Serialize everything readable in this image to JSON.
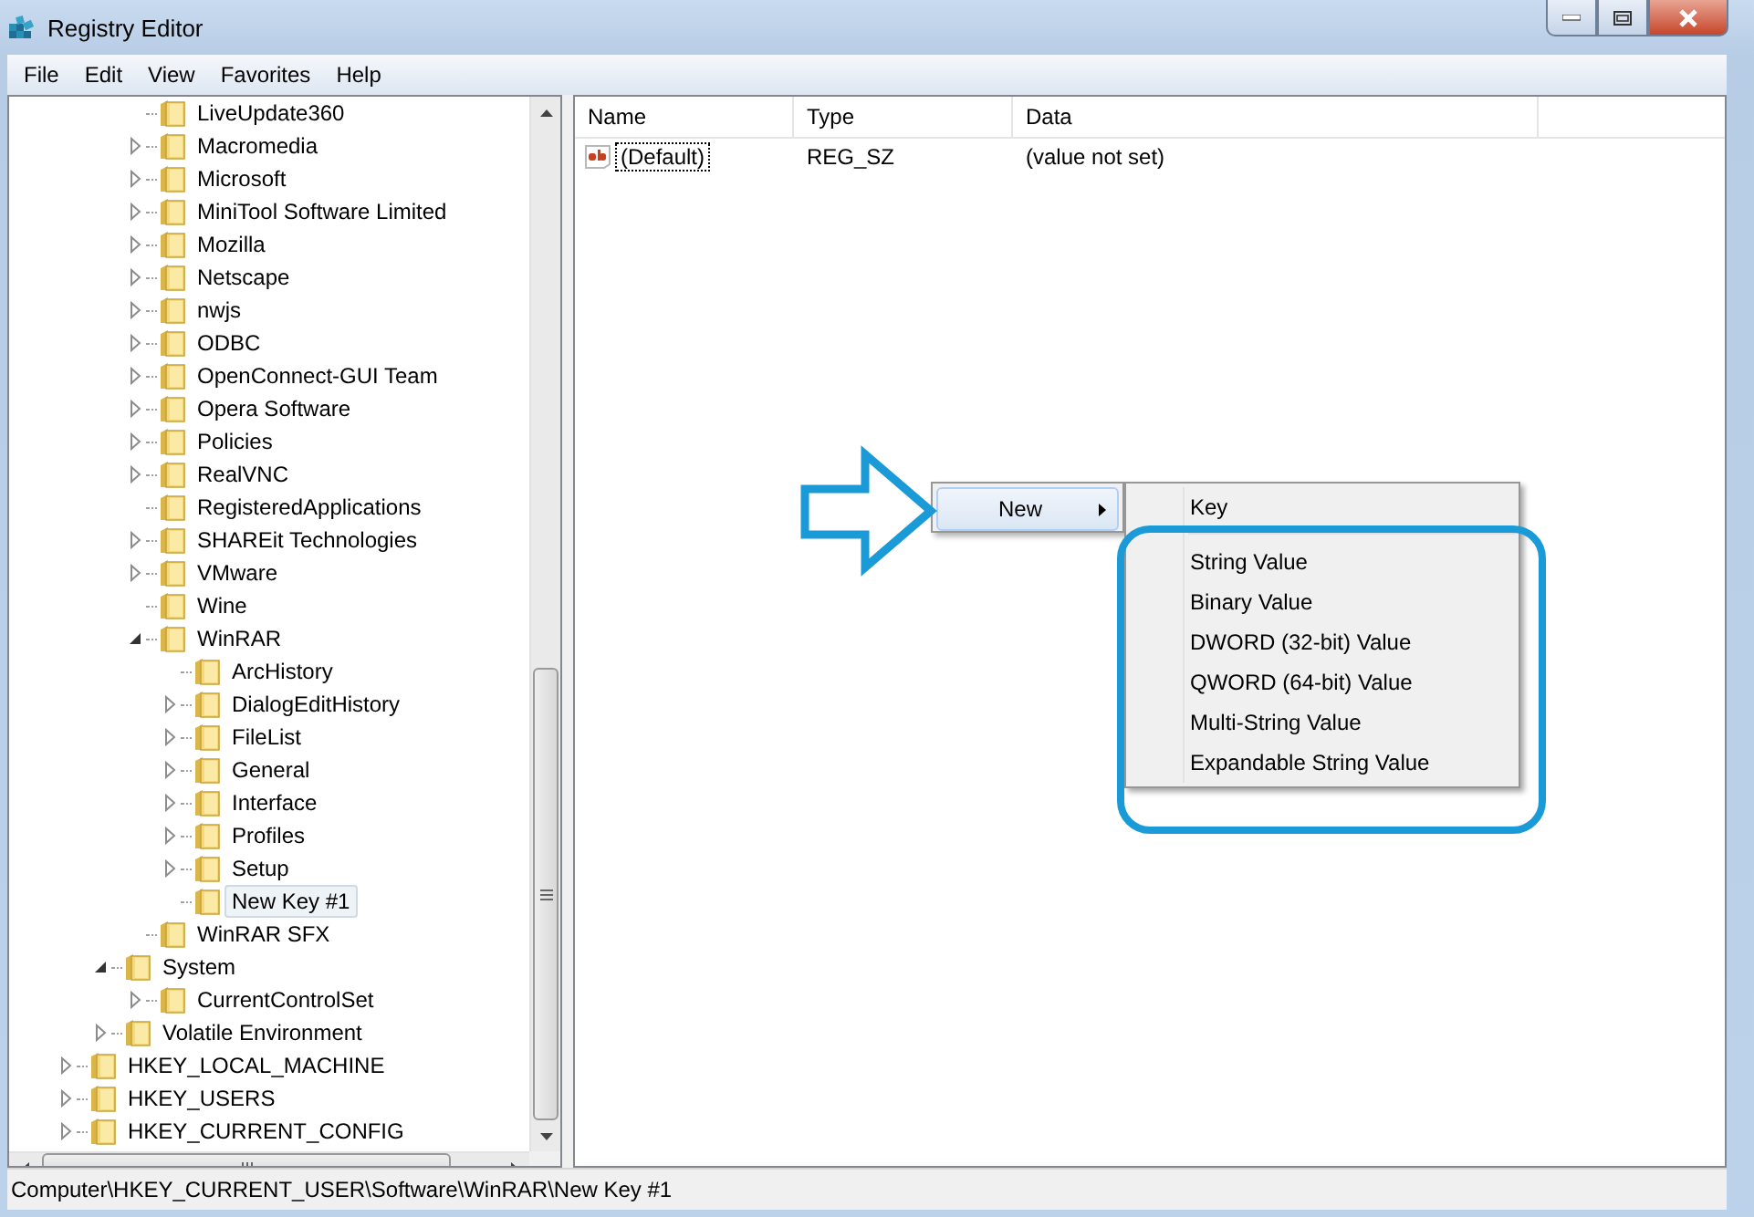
{
  "window": {
    "title": "Registry Editor"
  },
  "menu_bar": [
    "File",
    "Edit",
    "View",
    "Favorites",
    "Help"
  ],
  "tree": {
    "items": [
      {
        "children": [
          {
            "children": [
              {
                "label": "LiveUpdate360",
                "kind": "leaf",
                "selected": false
              },
              {
                "label": "Macromedia",
                "kind": "branch",
                "expanded": false,
                "selected": false
              },
              {
                "label": "Microsoft",
                "kind": "branch",
                "expanded": false,
                "selected": false
              },
              {
                "label": "MiniTool Software Limited",
                "kind": "branch",
                "expanded": false,
                "selected": false
              },
              {
                "label": "Mozilla",
                "kind": "branch",
                "expanded": false,
                "selected": false
              },
              {
                "label": "Netscape",
                "kind": "branch",
                "expanded": false,
                "selected": false
              },
              {
                "label": "nwjs",
                "kind": "branch",
                "expanded": false,
                "selected": false
              },
              {
                "label": "ODBC",
                "kind": "branch",
                "expanded": false,
                "selected": false
              },
              {
                "label": "OpenConnect-GUI Team",
                "kind": "branch",
                "expanded": false,
                "selected": false
              },
              {
                "label": "Opera Software",
                "kind": "branch",
                "expanded": false,
                "selected": false
              },
              {
                "label": "Policies",
                "kind": "branch",
                "expanded": false,
                "selected": false
              },
              {
                "label": "RealVNC",
                "kind": "branch",
                "expanded": false,
                "selected": false
              },
              {
                "label": "RegisteredApplications",
                "kind": "leaf",
                "selected": false
              },
              {
                "label": "SHAREit Technologies",
                "kind": "branch",
                "expanded": false,
                "selected": false
              },
              {
                "label": "VMware",
                "kind": "branch",
                "expanded": false,
                "selected": false
              },
              {
                "label": "Wine",
                "kind": "leaf",
                "selected": false
              },
              {
                "label": "WinRAR",
                "kind": "branch",
                "expanded": true,
                "selected": false,
                "children": [
                  {
                    "label": "ArcHistory",
                    "kind": "leaf",
                    "selected": false
                  },
                  {
                    "label": "DialogEditHistory",
                    "kind": "branch",
                    "expanded": false,
                    "selected": false
                  },
                  {
                    "label": "FileList",
                    "kind": "branch",
                    "expanded": false,
                    "selected": false
                  },
                  {
                    "label": "General",
                    "kind": "branch",
                    "expanded": false,
                    "selected": false
                  },
                  {
                    "label": "Interface",
                    "kind": "branch",
                    "expanded": false,
                    "selected": false
                  },
                  {
                    "label": "Profiles",
                    "kind": "branch",
                    "expanded": false,
                    "selected": false
                  },
                  {
                    "label": "Setup",
                    "kind": "branch",
                    "expanded": false,
                    "selected": false
                  },
                  {
                    "label": "New Key #1",
                    "kind": "leaf",
                    "selected": true
                  }
                ]
              },
              {
                "label": "WinRAR SFX",
                "kind": "leaf",
                "selected": false
              }
            ]
          },
          {
            "label": "System",
            "kind": "branch",
            "expanded": true,
            "selected": false,
            "children": [
              {
                "label": "CurrentControlSet",
                "kind": "branch",
                "expanded": false,
                "selected": false
              }
            ]
          },
          {
            "label": "Volatile Environment",
            "kind": "branch",
            "expanded": false,
            "selected": false
          }
        ]
      },
      {
        "label": "HKEY_LOCAL_MACHINE",
        "kind": "branch",
        "expanded": false,
        "selected": false
      },
      {
        "label": "HKEY_USERS",
        "kind": "branch",
        "expanded": false,
        "selected": false
      },
      {
        "label": "HKEY_CURRENT_CONFIG",
        "kind": "branch",
        "expanded": false,
        "selected": false
      }
    ]
  },
  "values": {
    "columns": [
      "Name",
      "Type",
      "Data"
    ],
    "rows": [
      {
        "name": "(Default)",
        "type": "REG_SZ",
        "data": "(value not set)",
        "selected": true
      }
    ]
  },
  "context_menu": {
    "items": [
      {
        "label": "New",
        "has_submenu": true,
        "selected": true
      }
    ]
  },
  "submenu": {
    "items": [
      {
        "kind": "item",
        "label": "Key"
      },
      {
        "kind": "separator"
      },
      {
        "kind": "item",
        "label": "String Value"
      },
      {
        "kind": "item",
        "label": "Binary Value"
      },
      {
        "kind": "item",
        "label": "DWORD (32-bit) Value"
      },
      {
        "kind": "item",
        "label": "QWORD (64-bit) Value"
      },
      {
        "kind": "item",
        "label": "Multi-String Value"
      },
      {
        "kind": "item",
        "label": "Expandable String Value"
      }
    ]
  },
  "status_bar": "Computer\\HKEY_CURRENT_USER\\Software\\WinRAR\\New Key #1"
}
